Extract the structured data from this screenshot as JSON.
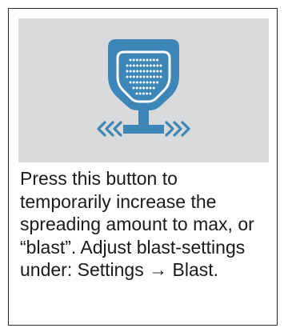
{
  "button_icon": {
    "icon": "blast-spreader-icon",
    "tile_color": "#d9dadb",
    "icon_color": "#3d86b8",
    "dot_color": "#ffffff"
  },
  "description": {
    "text": "Press this button to temporarily increase the spreading amount to max, or “blast”. Adjust blast-settings under: Settings → Blast."
  }
}
